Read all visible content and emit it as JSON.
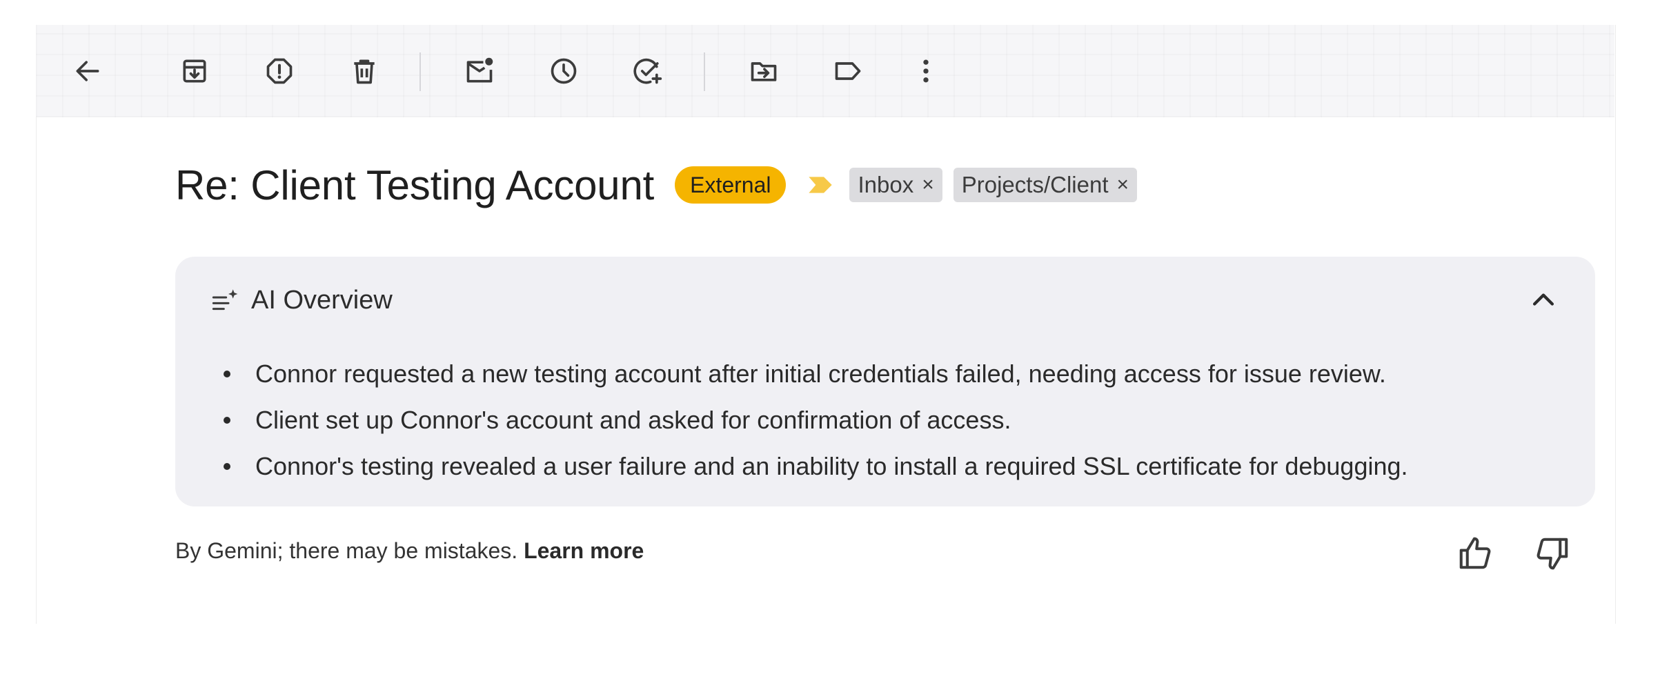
{
  "toolbar": {
    "buttons": [
      {
        "name": "back-button",
        "icon": "arrow-left-icon",
        "label": "Back"
      },
      {
        "name": "archive-button",
        "icon": "archive-icon",
        "label": "Archive"
      },
      {
        "name": "report-spam-button",
        "icon": "report-icon",
        "label": "Report spam"
      },
      {
        "name": "delete-button",
        "icon": "trash-icon",
        "label": "Delete"
      },
      {
        "name": "mark-unread-button",
        "icon": "mark-unread-icon",
        "label": "Mark as unread"
      },
      {
        "name": "snooze-button",
        "icon": "clock-icon",
        "label": "Snooze"
      },
      {
        "name": "add-to-tasks-button",
        "icon": "add-task-icon",
        "label": "Add to Tasks"
      },
      {
        "name": "move-to-button",
        "icon": "move-to-icon",
        "label": "Move to"
      },
      {
        "name": "labels-button",
        "icon": "label-icon",
        "label": "Labels"
      },
      {
        "name": "more-button",
        "icon": "more-vert-icon",
        "label": "More"
      }
    ]
  },
  "message": {
    "subject": "Re: Client Testing Account",
    "external_badge": "External",
    "labels": [
      {
        "text": "Inbox",
        "remove": "×"
      },
      {
        "text": "Projects/Client",
        "remove": "×"
      }
    ]
  },
  "ai_overview": {
    "title": "AI Overview",
    "bullets": [
      "Connor requested a new testing account after initial credentials failed, needing access for issue review.",
      "Client set up Connor's account and asked for confirmation of access.",
      "Connor's testing revealed a user failure and an inability to install a required SSL certificate for debugging."
    ],
    "disclaimer": "By Gemini; there may be mistakes.",
    "learn_more": "Learn more"
  },
  "colors": {
    "external_badge": "#f5b400",
    "importance_marker": "#f7c948",
    "card_background": "#f0f0f4",
    "chip_background": "#dcdcdf"
  }
}
